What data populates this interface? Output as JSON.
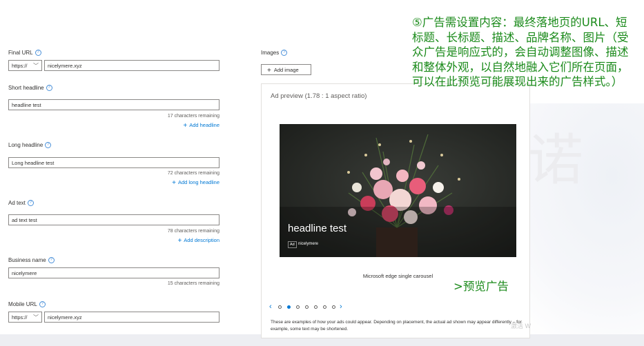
{
  "form": {
    "final_url": {
      "label": "Final URL",
      "protocol": "https://",
      "value": "nicelymere.xyz"
    },
    "short_headline": {
      "label": "Short headline",
      "value": "headline test",
      "remaining": "17 characters remaining",
      "add_label": "Add headline"
    },
    "long_headline": {
      "label": "Long headline",
      "value": "Long headline test",
      "remaining": "72 characters remaining",
      "add_label": "Add long headline"
    },
    "ad_text": {
      "label": "Ad text",
      "value": "ad text test",
      "remaining": "78 characters remaining",
      "add_label": "Add description"
    },
    "business_name": {
      "label": "Business name",
      "value": "nicelymere",
      "remaining": "15 characters remaining"
    },
    "mobile_url": {
      "label": "Mobile URL",
      "protocol": "https://",
      "value": "nicelymere.xyz"
    }
  },
  "images": {
    "label": "Images",
    "add_button": "Add image"
  },
  "preview": {
    "title": "Ad preview (1.78 : 1 aspect ratio)",
    "headline": "headline test",
    "ad_badge": "Ad",
    "business": "nicelymere",
    "caption": "Microsoft edge single carousel",
    "pager_count": 7,
    "pager_active": 1,
    "disclaimer": "These are examples of how your ads could appear. Depending on placement, the actual ad shown may appear differently – for example, some text may be shortened."
  },
  "annotations": {
    "main": "⑤广告需设置内容：最终落地页的URL、短标题、长标题、描述、品牌名称、图片（受众广告是响应式的，会自动调整图像、描述和整体外观，以自然地融入它们所在页面，可以在此预览可能展现出来的广告样式。）",
    "preview_note": ">预览广告"
  },
  "decor": {
    "big_char": "诺",
    "watermark": "激活 W"
  },
  "colors": {
    "accent": "#0078d4",
    "annotation": "#1a8a1a"
  }
}
